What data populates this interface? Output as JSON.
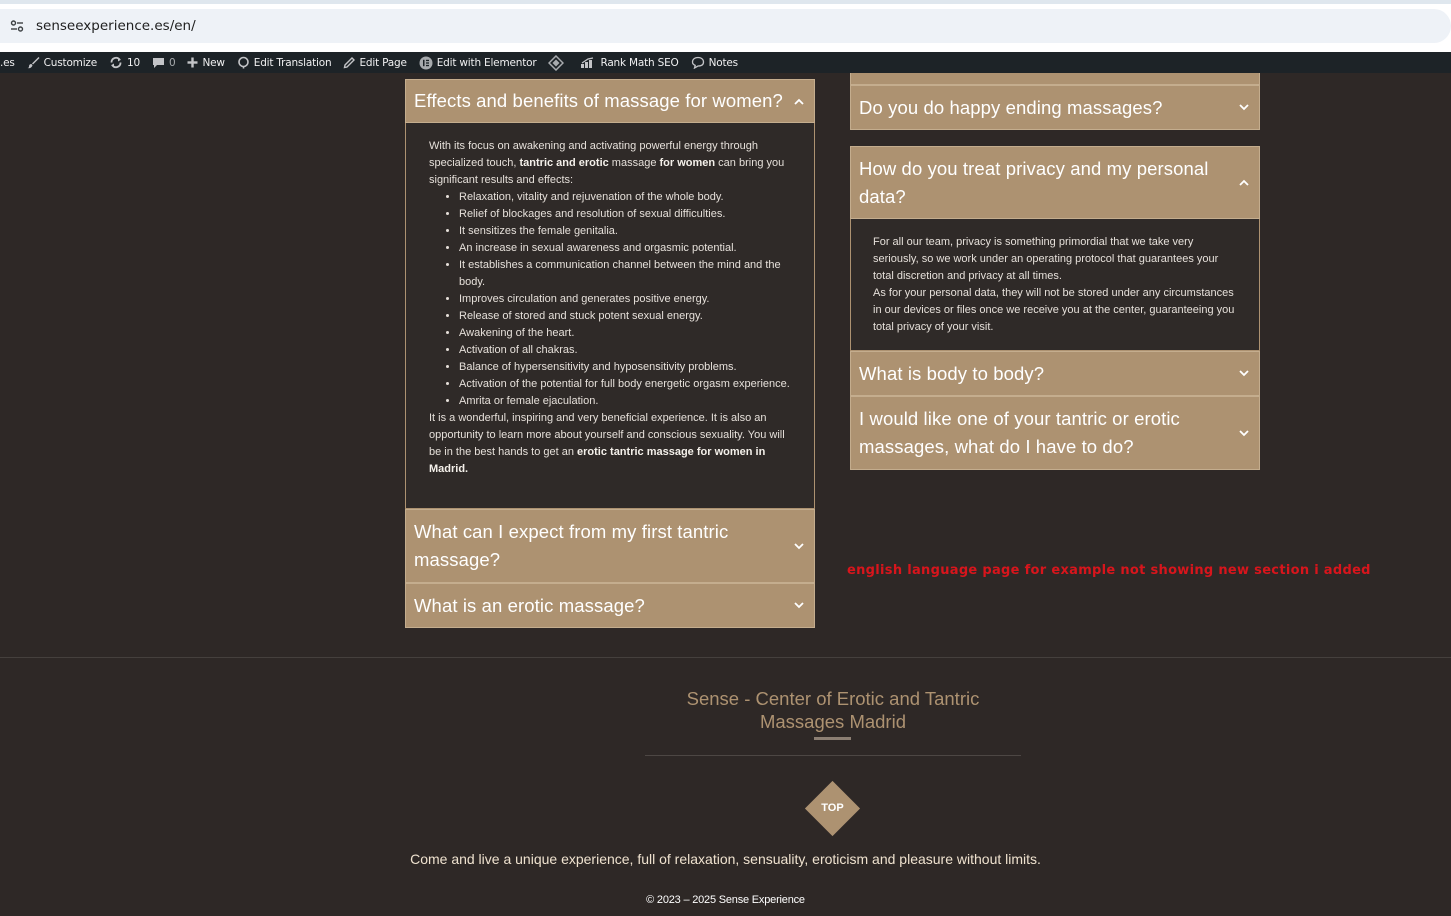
{
  "browser": {
    "url": "senseexperience.es/en/"
  },
  "adminbar": {
    "site_fragment": ".es",
    "customize": "Customize",
    "updates_count": "10",
    "comments_count": "0",
    "new": "New",
    "edit_translation": "Edit Translation",
    "edit_page": "Edit Page",
    "edit_elementor": "Edit with Elementor",
    "rank_math": "Rank Math SEO",
    "notes": "Notes"
  },
  "left_faq": {
    "item1": {
      "title": "Effects and benefits of massage for women?",
      "intro_1": "With its focus on awakening and activating powerful energy through specialized touch, ",
      "intro_bold_1": "tantric and erotic",
      "intro_2": " massage ",
      "intro_bold_2": "for women",
      "intro_3": " can bring you significant results and effects:",
      "bullets": [
        "Relaxation, vitality and rejuvenation of the whole body.",
        "Relief of blockages and resolution of sexual difficulties.",
        "It sensitizes the female genitalia.",
        "An increase in sexual awareness and orgasmic potential.",
        "It establishes a communication channel between the mind and the body.",
        "Improves circulation and generates positive energy.",
        "Release of stored and stuck potent sexual energy.",
        "Awakening of the heart.",
        "Activation of all chakras.",
        "Balance of hypersensitivity and hyposensitivity problems.",
        "Activation of the potential for full body energetic orgasm experience.",
        "Amrita or female ejaculation."
      ],
      "outro_1": "It is a wonderful, inspiring and very beneficial experience. It is also an opportunity to learn more about yourself and conscious sexuality. You will be in the best hands to get an ",
      "outro_bold": "erotic tantric massage for women in Madrid."
    },
    "item2": {
      "title": "What can I expect from my first tantric massage?"
    },
    "item3": {
      "title": "What is an erotic massage?"
    }
  },
  "right_faq": {
    "item1": {
      "title": "Do you do happy ending massages?"
    },
    "item2": {
      "title": "How do you treat privacy and my personal data?",
      "para1": "For all our team, privacy is something primordial that we take very seriously, so we work under an operating protocol that guarantees your total discretion and privacy at all times.",
      "para2": "As for your personal data, they will not be stored under any circumstances in our devices or files once we receive you at the center, guaranteeing you total privacy of your visit."
    },
    "item3": {
      "title": "What is body to body?"
    },
    "item4": {
      "title": "I would like one of your tantric or erotic massages, what do I have to do?"
    }
  },
  "annotation": "english language page for example not showing new section i added",
  "footer": {
    "title": "Sense - Center of Erotic and Tantric Massages Madrid",
    "top_label": "TOP",
    "tagline": "Come and live a unique experience, full of relaxation, sensuality, eroticism and pleasure without limits.",
    "copyright": "© 2023 – 2025 Sense Experience"
  },
  "colors": {
    "page_bg": "#2e2826",
    "accordion_accent": "#ad9271",
    "annotation_red": "#d8151c"
  }
}
